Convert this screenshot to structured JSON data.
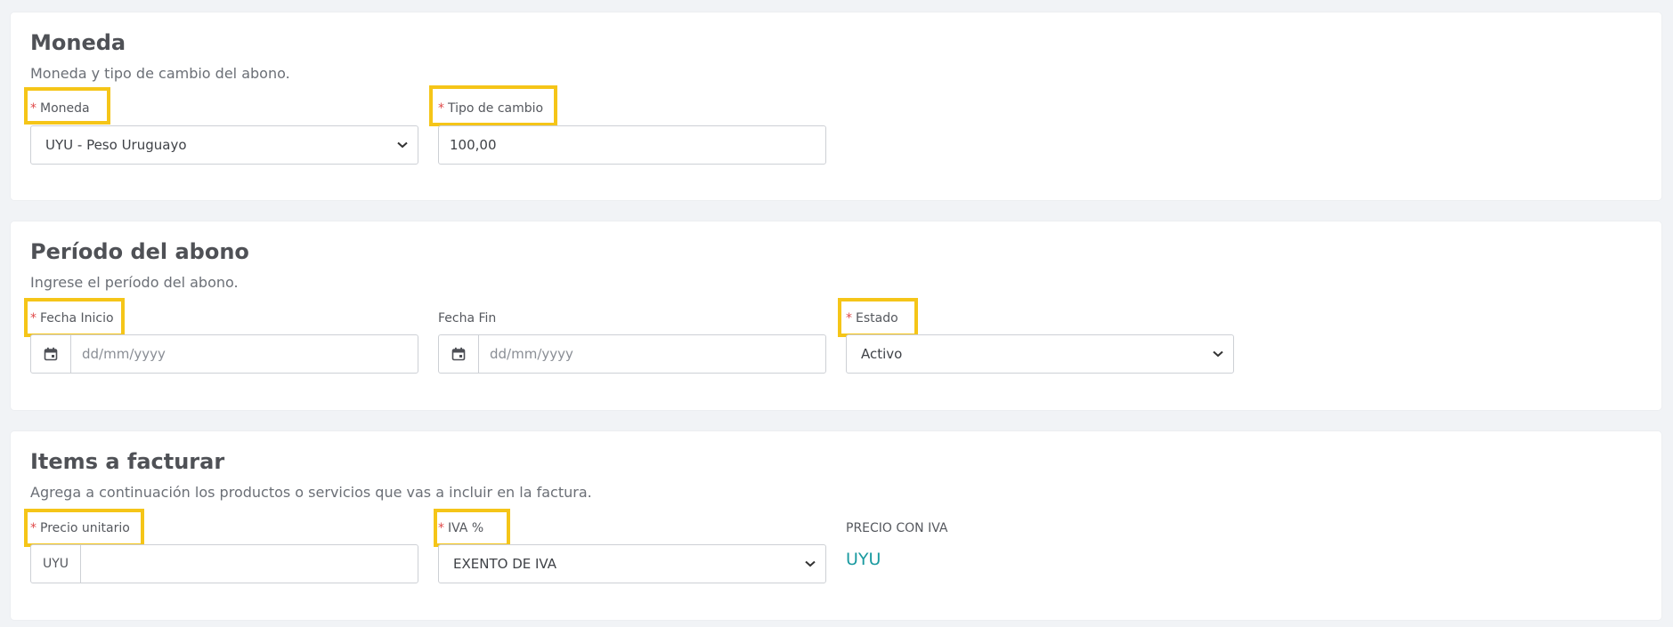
{
  "moneda_section": {
    "title": "Moneda",
    "subtitle": "Moneda y tipo de cambio del abono.",
    "moneda_label": "Moneda",
    "moneda_value": "UYU - Peso Uruguayo",
    "tipo_cambio_label": "Tipo de cambio",
    "tipo_cambio_value": "100,00"
  },
  "periodo_section": {
    "title": "Período del abono",
    "subtitle": "Ingrese el período del abono.",
    "fecha_inicio_label": "Fecha Inicio",
    "fecha_inicio_placeholder": "dd/mm/yyyy",
    "fecha_fin_label": "Fecha Fin",
    "fecha_fin_placeholder": "dd/mm/yyyy",
    "estado_label": "Estado",
    "estado_value": "Activo"
  },
  "items_section": {
    "title": "Items a facturar",
    "subtitle": "Agrega a continuación los productos o servicios que vas a incluir en la factura.",
    "precio_label": "Precio unitario",
    "precio_prefix": "UYU",
    "precio_value": "",
    "iva_label": "IVA %",
    "iva_value": "EXENTO DE IVA",
    "precio_con_iva_label": "PRECIO CON IVA",
    "precio_con_iva_value": "UYU"
  },
  "required_marker": "*",
  "colors": {
    "highlight": "#f5c518",
    "required": "#e04a4a",
    "accent": "#1a9aa0",
    "background": "#f1f3f6"
  },
  "icons": {
    "calendar": "calendar-icon",
    "chevron": "chevron-down-icon"
  }
}
